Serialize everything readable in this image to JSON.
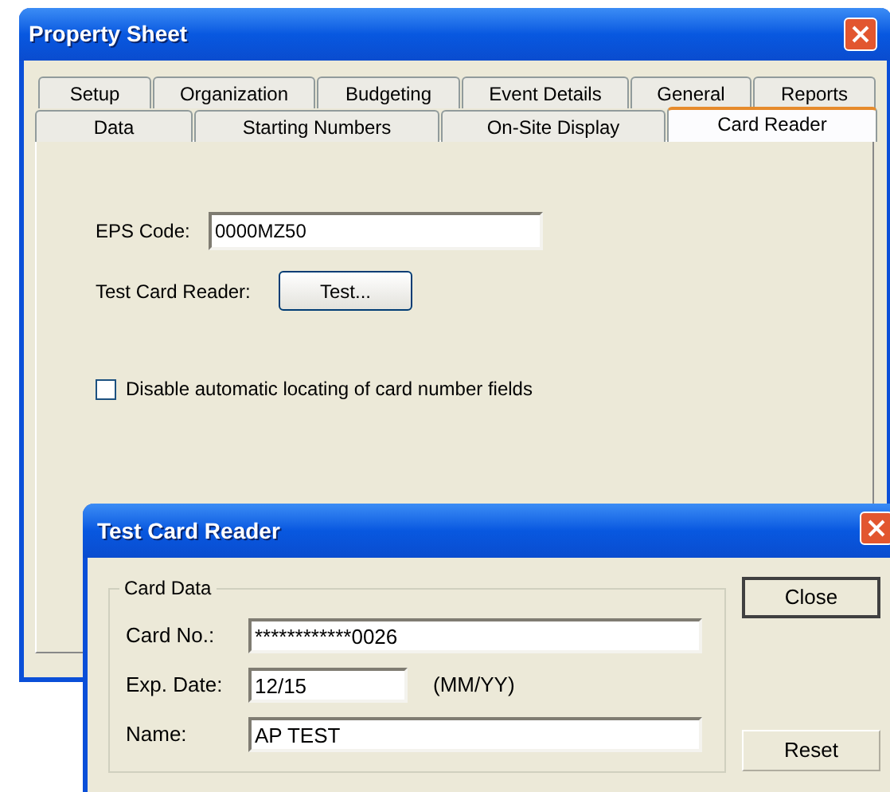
{
  "property_sheet": {
    "title": "Property Sheet",
    "tab_rows": [
      [
        {
          "label": "Setup",
          "selected": false
        },
        {
          "label": "Organization",
          "selected": false
        },
        {
          "label": "Budgeting",
          "selected": false
        },
        {
          "label": "Event Details",
          "selected": false
        },
        {
          "label": "General",
          "selected": false
        },
        {
          "label": "Reports",
          "selected": false
        }
      ],
      [
        {
          "label": "Data",
          "selected": false
        },
        {
          "label": "Starting Numbers",
          "selected": false
        },
        {
          "label": "On-Site Display",
          "selected": false
        },
        {
          "label": "Card Reader",
          "selected": true
        }
      ]
    ],
    "eps_code": {
      "label": "EPS Code:",
      "value": "0000MZ50"
    },
    "test_card_reader": {
      "label": "Test Card Reader:",
      "button": "Test..."
    },
    "disable_auto_locate": {
      "label": "Disable automatic locating of card number fields",
      "checked": false
    }
  },
  "dialog": {
    "title": "Test Card Reader",
    "group": "Card Data",
    "fields": [
      {
        "label": "Card No.:",
        "value": "************0026"
      },
      {
        "label": "Exp. Date:",
        "value": "12/15",
        "hint": "(MM/YY)"
      },
      {
        "label": "Name:",
        "value": "AP TEST"
      }
    ],
    "buttons": [
      "Close",
      "Reset"
    ]
  }
}
